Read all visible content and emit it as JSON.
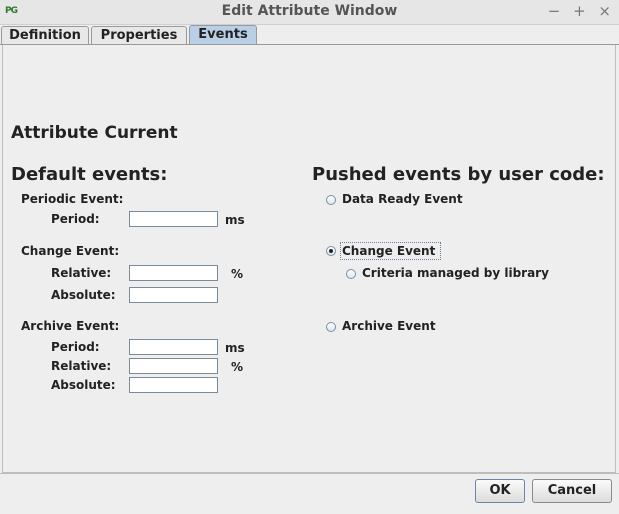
{
  "window": {
    "app_icon": "PG",
    "title": "Edit Attribute Window",
    "controls": [
      "−",
      "+",
      "×"
    ]
  },
  "tabs": [
    {
      "label": "Definition",
      "active": false
    },
    {
      "label": "Properties",
      "active": false
    },
    {
      "label": "Events",
      "active": true
    }
  ],
  "attribute_title": "Attribute Current",
  "default_events": {
    "heading": "Default events:",
    "periodic": {
      "label": "Periodic Event:",
      "period_label": "Period:",
      "period_value": "",
      "period_unit": "ms"
    },
    "change": {
      "label": "Change Event:",
      "relative_label": "Relative:",
      "relative_value": "",
      "relative_unit": "%",
      "absolute_label": "Absolute:",
      "absolute_value": ""
    },
    "archive": {
      "label": "Archive Event:",
      "period_label": "Period:",
      "period_value": "",
      "period_unit": "ms",
      "relative_label": "Relative:",
      "relative_value": "",
      "relative_unit": "%",
      "absolute_label": "Absolute:",
      "absolute_value": ""
    }
  },
  "pushed_events": {
    "heading": "Pushed events by user code:",
    "data_ready": {
      "label": "Data Ready Event",
      "selected": false
    },
    "change": {
      "label": "Change Event",
      "selected": true
    },
    "criteria": {
      "label": "Criteria managed by library",
      "selected": false
    },
    "archive": {
      "label": "Archive Event",
      "selected": false
    }
  },
  "buttons": {
    "ok": "OK",
    "cancel": "Cancel"
  }
}
